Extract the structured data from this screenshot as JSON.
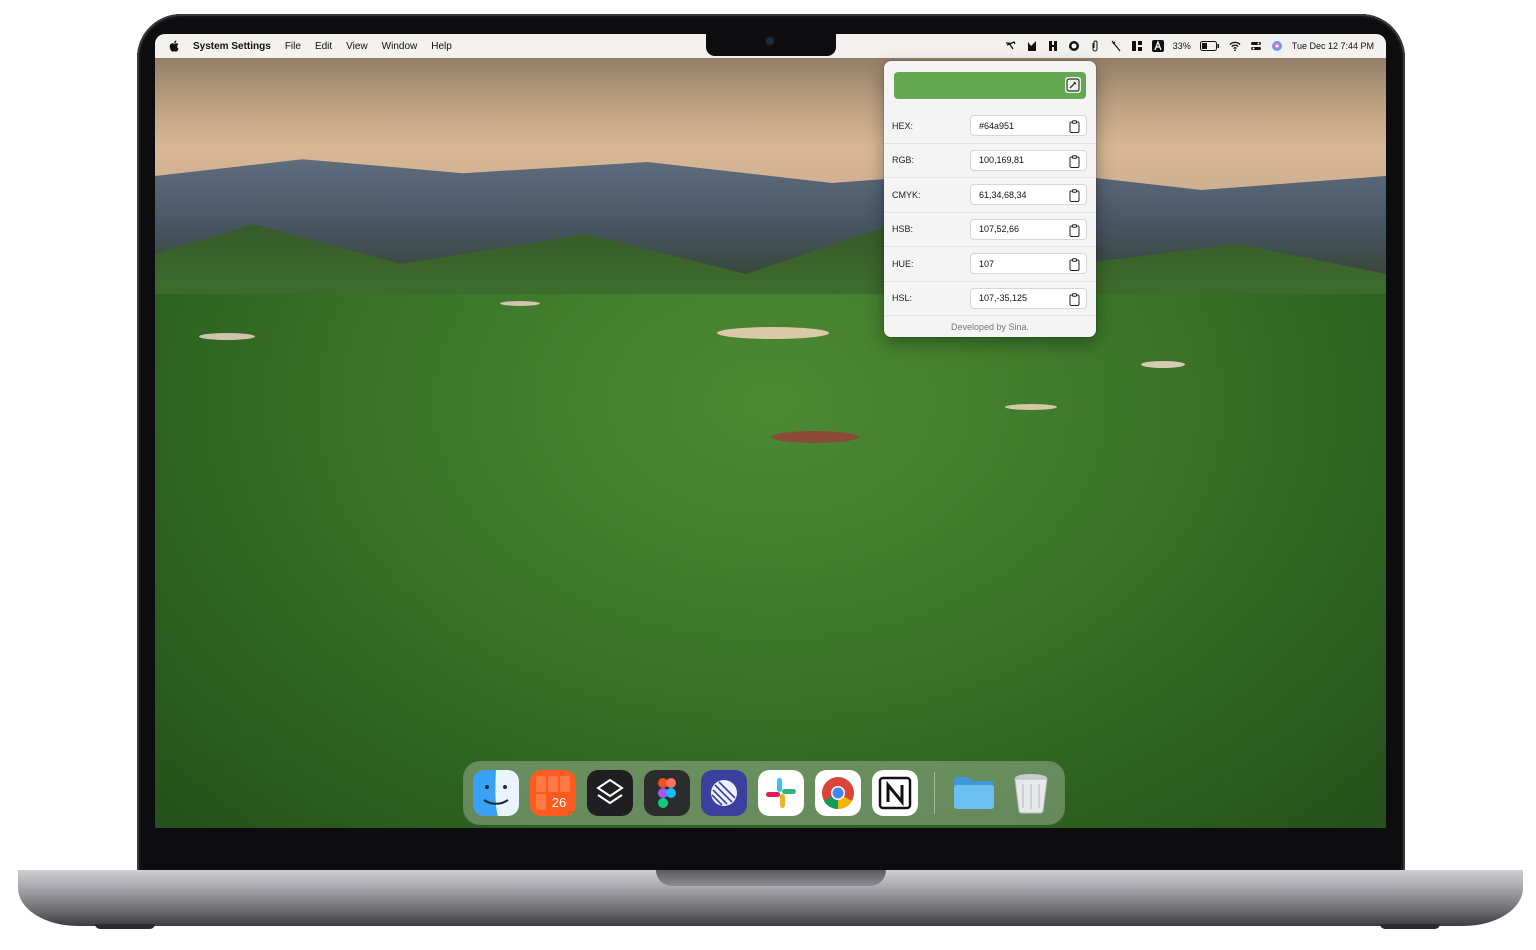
{
  "menubar": {
    "app_name": "System Settings",
    "menus": [
      "File",
      "Edit",
      "View",
      "Window",
      "Help"
    ],
    "battery": "33%",
    "datetime": "Tue Dec 12  7:44 PM",
    "tray_icons": [
      "screenshot-icon",
      "pen-tool-icon",
      "h-app-icon",
      "grammarly-icon",
      "paperclip-icon",
      "slash-tool-icon",
      "layout-grid-icon",
      "keyboard-input-icon",
      "battery-icon",
      "wifi-icon",
      "control-center-icon",
      "siri-icon"
    ]
  },
  "color_picker": {
    "swatch_color": "#64a951",
    "rows": [
      {
        "label": "HEX:",
        "value": "#64a951"
      },
      {
        "label": "RGB:",
        "value": "100,169,81"
      },
      {
        "label": "CMYK:",
        "value": "61,34,68,34"
      },
      {
        "label": "HSB:",
        "value": "107,52,66"
      },
      {
        "label": "HUE:",
        "value": "107"
      },
      {
        "label": "HSL:",
        "value": "107,-35,125"
      }
    ],
    "footer": "Developed by Sina."
  },
  "dock": {
    "apps": [
      {
        "name": "finder-icon",
        "color": "#2a8ef0"
      },
      {
        "name": "calendar-app-icon",
        "color": "#ff5a1f",
        "badge": "26"
      },
      {
        "name": "layers-app-icon",
        "color": "#1f1f22"
      },
      {
        "name": "figma-icon",
        "color": "#2c2c2c"
      },
      {
        "name": "linear-icon",
        "color": "#3b3f9e"
      },
      {
        "name": "slack-icon",
        "color": "#ffffff"
      },
      {
        "name": "chrome-icon",
        "color": "#ffffff"
      },
      {
        "name": "notion-icon",
        "color": "#ffffff"
      },
      {
        "name": "folder-icon",
        "color": "#4aa6e8"
      },
      {
        "name": "trash-icon",
        "color": "#e8eaec"
      }
    ]
  }
}
